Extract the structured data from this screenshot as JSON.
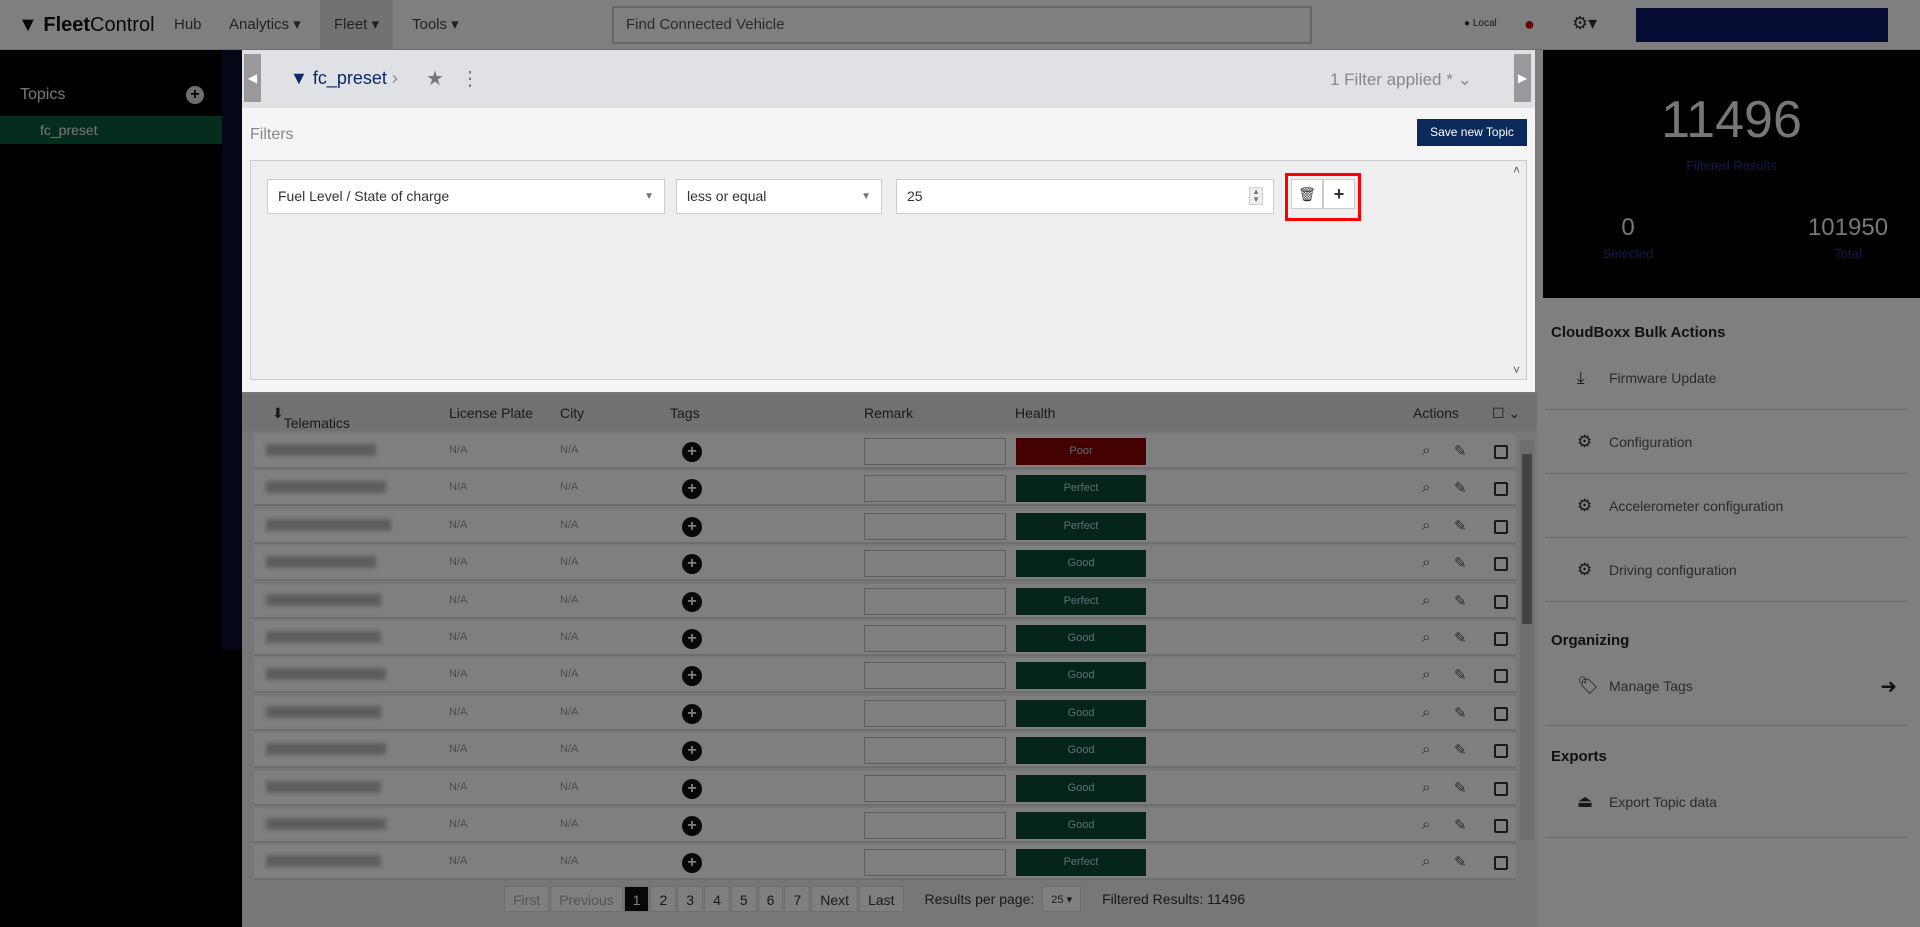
{
  "nav": {
    "logo_bold": "Fleet",
    "logo_light": "Control",
    "items": [
      {
        "label": "Hub"
      },
      {
        "label": "Analytics ▾"
      },
      {
        "label": "Fleet ▾"
      },
      {
        "label": "Tools ▾"
      }
    ],
    "search_placeholder": "Find Connected Vehicle",
    "local_label": "Local"
  },
  "sidebar": {
    "title": "Topics",
    "selected_topic": "fc_preset"
  },
  "modal": {
    "breadcrumb": "fc_preset",
    "filter_status": "1 Filter applied *",
    "filters_label": "Filters",
    "save_button": "Save new Topic",
    "filter": {
      "field": "Fuel Level / State of charge",
      "operator": "less or equal",
      "value": "25"
    }
  },
  "table": {
    "headers": {
      "id": "Telematics Unit ID",
      "plate": "License Plate",
      "city": "City",
      "tags": "Tags",
      "remark": "Remark",
      "health": "Health",
      "actions": "Actions"
    },
    "rows": [
      {
        "plate": "N/A",
        "city": "N/A",
        "health": "Poor"
      },
      {
        "plate": "N/A",
        "city": "N/A",
        "health": "Perfect"
      },
      {
        "plate": "N/A",
        "city": "N/A",
        "health": "Perfect"
      },
      {
        "plate": "N/A",
        "city": "N/A",
        "health": "Good"
      },
      {
        "plate": "N/A",
        "city": "N/A",
        "health": "Perfect"
      },
      {
        "plate": "N/A",
        "city": "N/A",
        "health": "Good"
      },
      {
        "plate": "N/A",
        "city": "N/A",
        "health": "Good"
      },
      {
        "plate": "N/A",
        "city": "N/A",
        "health": "Good"
      },
      {
        "plate": "N/A",
        "city": "N/A",
        "health": "Good"
      },
      {
        "plate": "N/A",
        "city": "N/A",
        "health": "Good"
      },
      {
        "plate": "N/A",
        "city": "N/A",
        "health": "Good"
      },
      {
        "plate": "N/A",
        "city": "N/A",
        "health": "Perfect"
      }
    ],
    "health_colors": {
      "Poor": "#8b0000",
      "Perfect": "#0a4a34",
      "Good": "#0a4a34"
    }
  },
  "pagination": {
    "first": "First",
    "previous": "Previous",
    "pages": [
      "1",
      "2",
      "3",
      "4",
      "5",
      "6",
      "7"
    ],
    "current": "1",
    "next": "Next",
    "last": "Last",
    "per_page_label": "Results per page:",
    "per_page": "25",
    "filtered_results": "Filtered Results: 11496"
  },
  "stats": {
    "filtered": "11496",
    "filtered_label": "Filtered Results",
    "selected": "0",
    "selected_label": "Selected",
    "total": "101950",
    "total_label": "Total"
  },
  "right": {
    "bulk_title": "CloudBoxx Bulk Actions",
    "bulk": [
      {
        "label": "Firmware Update",
        "icon": "download-icon"
      },
      {
        "label": "Configuration",
        "icon": "gear-icon"
      },
      {
        "label": "Accelerometer configuration",
        "icon": "gear-icon"
      },
      {
        "label": "Driving configuration",
        "icon": "gear-icon"
      }
    ],
    "organizing_title": "Organizing",
    "manage_tags": "Manage Tags",
    "exports_title": "Exports",
    "export_topic": "Export Topic data"
  }
}
